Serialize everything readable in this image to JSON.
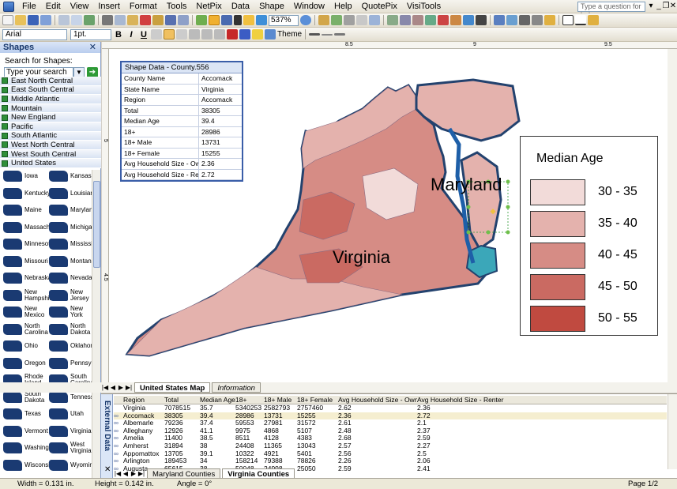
{
  "menu": [
    "File",
    "Edit",
    "View",
    "Insert",
    "Format",
    "Tools",
    "NetPix",
    "Data",
    "Shape",
    "Window",
    "Help",
    "QuotePix",
    "VisiTools"
  ],
  "help_placeholder": "Type a question for help",
  "toolbar": {
    "zoom": "537%",
    "font": "Arial",
    "font_size": "1pt.",
    "theme_label": "Theme"
  },
  "shapes_panel": {
    "title": "Shapes",
    "search_label": "Search for Shapes:",
    "search_placeholder": "Type your search here",
    "stencils": [
      "East North Central",
      "East South Central",
      "Middle Atlantic",
      "Mountain",
      "New England",
      "Pacific",
      "South Atlantic",
      "West North Central",
      "West South Central",
      "United States"
    ],
    "shapes": [
      [
        "Iowa",
        "Kansas"
      ],
      [
        "Kentucky",
        "Louisiana"
      ],
      [
        "Maine",
        "Maryland"
      ],
      [
        "Massach...",
        "Michigan"
      ],
      [
        "Minnesota",
        "Mississippi"
      ],
      [
        "Missouri",
        "Montana"
      ],
      [
        "Nebraska",
        "Nevada"
      ],
      [
        "New Hampshire",
        "New Jersey"
      ],
      [
        "New Mexico",
        "New York"
      ],
      [
        "North Carolina",
        "North Dakota"
      ],
      [
        "Ohio",
        "Oklahoma"
      ],
      [
        "Oregon",
        "Pennsylv..."
      ],
      [
        "Rhode Island",
        "South Carolina"
      ],
      [
        "South Dakota",
        "Tennessee"
      ],
      [
        "Texas",
        "Utah"
      ],
      [
        "Vermont",
        "Virginia"
      ],
      [
        "Washington",
        "West Virginia"
      ],
      [
        "Wisconsin",
        "Wyoming"
      ]
    ]
  },
  "ruler": {
    "h": [
      "8.5",
      "9",
      "9.5"
    ],
    "v": [
      "5",
      "4.5"
    ]
  },
  "shape_data": {
    "title": "Shape Data - County.556",
    "rows": [
      [
        "County Name",
        "Accomack"
      ],
      [
        "State Name",
        "Virginia"
      ],
      [
        "Region",
        "Accomack"
      ],
      [
        "Total",
        "38305"
      ],
      [
        "Median Age",
        "39.4"
      ],
      [
        "18+",
        "28986"
      ],
      [
        "18+ Male",
        "13731"
      ],
      [
        "18+ Female",
        "15255"
      ],
      [
        "Avg Household Size - Owner",
        "2.36"
      ],
      [
        "Avg Household Size - Renter",
        "2.72"
      ]
    ]
  },
  "map": {
    "label_maryland": "Maryland",
    "label_virginia": "Virginia"
  },
  "legend": {
    "title": "Median Age",
    "items": [
      {
        "label": "30 - 35",
        "color": "#f2dbd9"
      },
      {
        "label": "35 - 40",
        "color": "#e4b2ad"
      },
      {
        "label": "40 - 45",
        "color": "#d68c85"
      },
      {
        "label": "45 - 50",
        "color": "#ca6a62"
      },
      {
        "label": "50 - 55",
        "color": "#c04a40"
      }
    ]
  },
  "page_tabs": [
    "United States Map",
    "Information"
  ],
  "external_data": {
    "label": "External Data",
    "headers": [
      "",
      "Region",
      "Total",
      "Median Age",
      "18+",
      "18+ Male",
      "18+ Female",
      "Avg Household Size - Owner",
      "Avg Household Size - Renter"
    ],
    "rows": [
      [
        "",
        "Virginia",
        "7078515",
        "35.7",
        "5340253",
        "2582793",
        "2757460",
        "2.62",
        "2.36"
      ],
      [
        "∞",
        "Accomack",
        "38305",
        "39.4",
        "28986",
        "13731",
        "15255",
        "2.36",
        "2.72"
      ],
      [
        "∞",
        "Albemarle",
        "79236",
        "37.4",
        "59553",
        "27981",
        "31572",
        "2.61",
        "2.1"
      ],
      [
        "∞",
        "Alleghany",
        "12926",
        "41.1",
        "9975",
        "4868",
        "5107",
        "2.48",
        "2.37"
      ],
      [
        "∞",
        "Amelia",
        "11400",
        "38.5",
        "8511",
        "4128",
        "4383",
        "2.68",
        "2.59"
      ],
      [
        "∞",
        "Amherst",
        "31894",
        "38",
        "24408",
        "11365",
        "13043",
        "2.57",
        "2.27"
      ],
      [
        "∞",
        "Appomattox",
        "13705",
        "39.1",
        "10322",
        "4921",
        "5401",
        "2.56",
        "2.5"
      ],
      [
        "∞",
        "Arlington",
        "189453",
        "34",
        "158214",
        "79388",
        "78826",
        "2.26",
        "2.06"
      ],
      [
        "∞",
        "Augusta",
        "65615",
        "38",
        "50048",
        "24998",
        "25050",
        "2.59",
        "2.41"
      ]
    ],
    "tabs": [
      "Maryland Counties",
      "Virginia Counties"
    ]
  },
  "status": {
    "width": "Width = 0.131 in.",
    "height": "Height = 0.142 in.",
    "angle": "Angle = 0°",
    "page": "Page 1/2"
  }
}
